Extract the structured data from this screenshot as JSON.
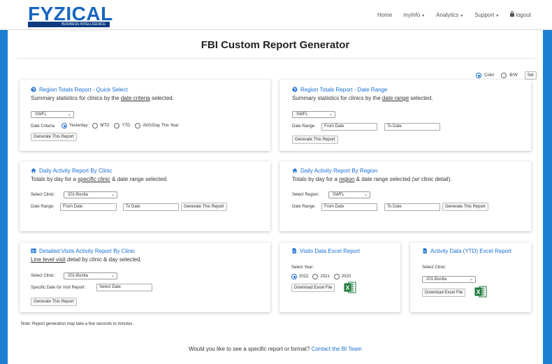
{
  "brand": {
    "name": "FYZICAL",
    "subtitle": "BUSINESS INTELLIGENCE"
  },
  "nav": {
    "home": "Home",
    "myinfo": "myInfo",
    "analytics": "Analytics",
    "support": "Support",
    "logout": "logout"
  },
  "page": {
    "title": "FBI Custom Report Generator"
  },
  "color_mode": {
    "color": "Color",
    "bw": "B/W",
    "set": "Set",
    "selected": "Color"
  },
  "cards": {
    "region_quick": {
      "title": "Region Totals Report - Quick Select",
      "desc_pre": "Summary statistics for clinics by the ",
      "desc_link": "date criteria",
      "desc_post": " selected.",
      "region": "SWFL",
      "date_criteria_label": "Date Criteria:",
      "options": [
        "Yesterday",
        "MTD",
        "YTD",
        "AVG/Day This Year"
      ],
      "selected": "Yesterday",
      "button": "Generate This Report"
    },
    "region_range": {
      "title": "Region Totals Report - Date Range",
      "desc_pre": "Summary statistics for clinics by the ",
      "desc_link": "date range",
      "desc_post": " selected.",
      "region": "SWFL",
      "date_range_label": "Date Range:",
      "from_placeholder": "From Date",
      "to_placeholder": "To Date",
      "button": "Generate This Report"
    },
    "daily_clinic": {
      "title": "Daily Activity Report By Clinic",
      "desc_pre": "Totals by day for a ",
      "desc_link": "specific clinic",
      "desc_post": " & date range selected.",
      "clinic_label": "Select Clinic:",
      "clinic": "201-Bonita",
      "date_range_label": "Date Range:",
      "from_placeholder": "From Date",
      "to_placeholder": "To Date",
      "button": "Generate This Report"
    },
    "daily_region": {
      "title": "Daily Activity Report By Region",
      "desc_pre": "Totals by day for a ",
      "desc_link": "region",
      "desc_post": " & date range selected (w/ clinic detail).",
      "region_label": "Select Region:",
      "region": "SWFL",
      "date_range_label": "Date Range:",
      "from_placeholder": "From Date",
      "to_placeholder": "To Date",
      "button": "Generate This Report"
    },
    "detailed_visits": {
      "title": "Detailed Visits Activity Report By Clinic",
      "desc_link": "Line level visit",
      "desc_post": " detail by clinic & day selected.",
      "clinic_label": "Select Clinic:",
      "clinic": "201-Bonita",
      "date_label": "Specific Date for Visit Report:",
      "date_placeholder": "Select Date",
      "button": "Generate This Report"
    },
    "visits_excel": {
      "title": "Visits Data Excel Report",
      "year_label": "Select Year:",
      "years": [
        "2022",
        "2021",
        "2020"
      ],
      "selected": "2022",
      "button": "Download Excel File"
    },
    "activity_excel": {
      "title": "Activity Data (YTD) Excel Report",
      "clinic_label": "Select Clinic:",
      "clinic": "201-Bonita",
      "button": "Download Excel File"
    }
  },
  "note": "Note: Report generation may take a few seconds to minutes.",
  "footer": {
    "text": "Would you like to see a specific report or format? ",
    "link": "Contact the BI Team"
  },
  "colors": {
    "accent": "#1a6fd0",
    "frame": "#1b7fd4",
    "excel": "#1d7a3a"
  }
}
